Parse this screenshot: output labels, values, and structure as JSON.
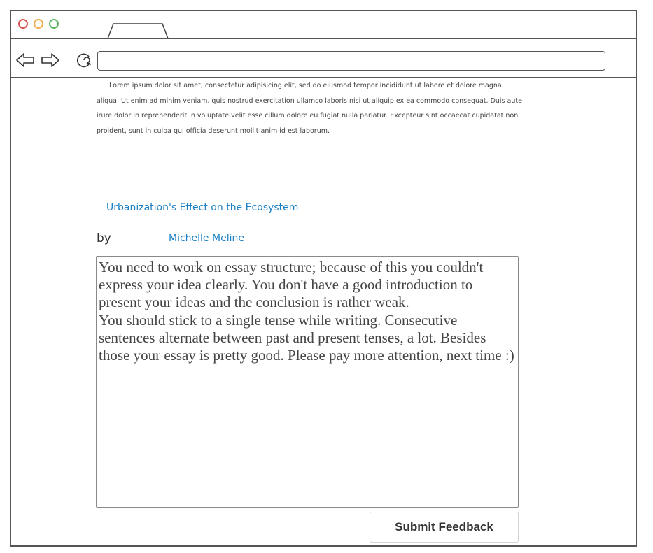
{
  "browser": {
    "window_dots": [
      "red",
      "orange",
      "green"
    ],
    "nav_icons": [
      "back-arrow-icon",
      "forward-arrow-icon",
      "reload-icon"
    ],
    "url": ""
  },
  "content": {
    "lorem": "Lorem ipsum dolor sit amet, consectetur adipisicing elit, sed do eiusmod tempor incididunt ut labore et dolore magna aliqua. Ut enim ad minim veniam, quis nostrud exercitation ullamco laboris nisi ut aliquip ex ea commodo consequat. Duis aute irure dolor in reprehenderit in voluptate velit esse cillum dolore eu fugiat nulla pariatur. Excepteur sint occaecat cupidatat non proident, sunt in culpa qui officia deserunt mollit anim id est laborum.",
    "essay_title": "Urbanization's Effect on the Ecosystem",
    "by_label": "by",
    "author": "Michelle Meline",
    "feedback": "You need to work on essay structure; because of this you couldn't express your idea clearly. You don't have a good introduction to present your ideas and the conclusion is rather weak.\nYou should stick to a single tense while writing. Consecutive sentences alternate between past and present tenses, a lot. Besides those your essay is pretty good. Please pay more attention, next time :)",
    "submit_label": "Submit Feedback"
  },
  "colors": {
    "accent_link": "#1a7fc4",
    "window_red": "#d9534f",
    "window_orange": "#f0ad4e",
    "window_green": "#5cb85c"
  }
}
